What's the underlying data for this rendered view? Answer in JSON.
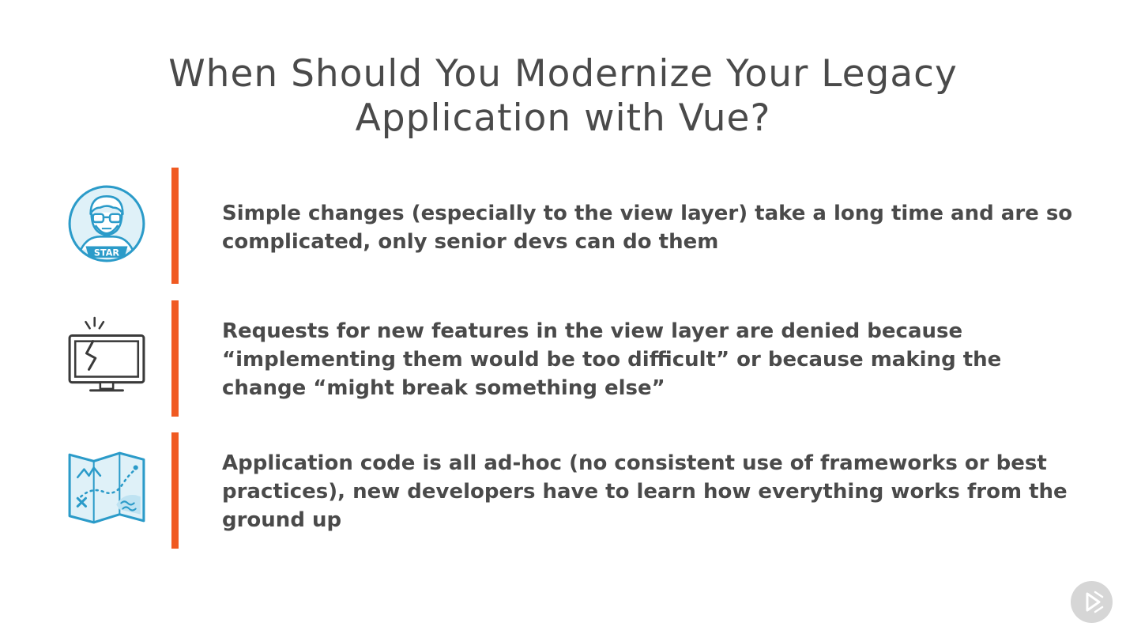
{
  "slide": {
    "title_line1": "When Should You Modernize Your Legacy",
    "title_line2": "Application with Vue?",
    "items": [
      {
        "icon": "star-developer-avatar-icon",
        "icon_label": "STAR",
        "text": "Simple changes (especially to the view layer) take a long time and are so complicated, only senior devs can do them"
      },
      {
        "icon": "broken-monitor-icon",
        "text": "Requests for new features in the view layer are denied because “implementing them would be too difficult” or because making the change “might break something else”"
      },
      {
        "icon": "treasure-map-icon",
        "text": "Application code is all ad-hoc (no consistent use of frameworks or best practices), new developers have to learn how everything works from the ground up"
      }
    ]
  },
  "colors": {
    "accent": "#f05a22",
    "text": "#4a4a4a",
    "icon_blue": "#2b9bc9",
    "icon_blue_light": "#dff1f8"
  },
  "player": {
    "icon": "play-icon"
  }
}
